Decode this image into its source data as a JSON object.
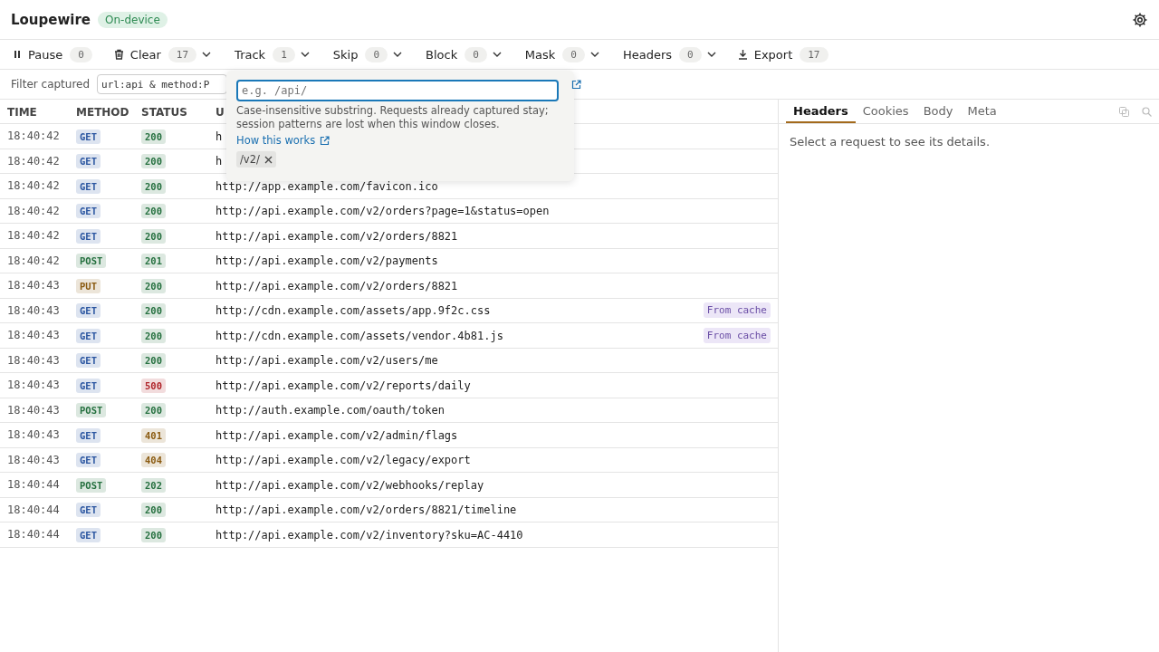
{
  "app": {
    "title": "Loupewire",
    "badge": "On-device"
  },
  "toolbar": [
    {
      "label": "Pause",
      "kind": "pause",
      "count": "0",
      "menu": false
    },
    {
      "label": "Clear",
      "kind": "trash",
      "count": "17",
      "menu": true
    },
    {
      "label": "Track",
      "kind": "plain",
      "count": "1",
      "menu": true
    },
    {
      "label": "Skip",
      "kind": "plain",
      "count": "0",
      "menu": true
    },
    {
      "label": "Block",
      "kind": "plain",
      "count": "0",
      "menu": true
    },
    {
      "label": "Mask",
      "kind": "plain",
      "count": "0",
      "menu": true
    },
    {
      "label": "Headers",
      "kind": "plain",
      "count": "0",
      "menu": true
    },
    {
      "label": "Export",
      "kind": "download",
      "count": "17",
      "menu": false
    }
  ],
  "filter": {
    "label": "Filter captured",
    "value": "url:api & method:P"
  },
  "popover": {
    "placeholder": "e.g. /api/",
    "help": "Case-insensitive substring. Requests already captured stay; session patterns are lost when this window closes.",
    "link": "How this works",
    "chips": [
      "/v2/"
    ]
  },
  "table": {
    "columns": [
      "TIME",
      "METHOD",
      "STATUS",
      "U"
    ],
    "rows": [
      {
        "time": "18:40:42",
        "method": {
          "text": "GET",
          "color": "#2a55a0"
        },
        "status": {
          "text": "200",
          "color": "#25703f"
        },
        "url": "h"
      },
      {
        "time": "18:40:42",
        "method": {
          "text": "GET",
          "color": "#2a55a0"
        },
        "status": {
          "text": "200",
          "color": "#25703f"
        },
        "url": "h"
      },
      {
        "time": "18:40:42",
        "method": {
          "text": "GET",
          "color": "#2a55a0"
        },
        "status": {
          "text": "200",
          "color": "#25703f"
        },
        "url": "http://app.example.com/favicon.ico"
      },
      {
        "time": "18:40:42",
        "method": {
          "text": "GET",
          "color": "#2a55a0"
        },
        "status": {
          "text": "200",
          "color": "#25703f"
        },
        "url": "http://api.example.com/v2/orders?page=1&status=open"
      },
      {
        "time": "18:40:42",
        "method": {
          "text": "GET",
          "color": "#2a55a0"
        },
        "status": {
          "text": "200",
          "color": "#25703f"
        },
        "url": "http://api.example.com/v2/orders/8821"
      },
      {
        "time": "18:40:42",
        "method": {
          "text": "POST",
          "color": "#25703f"
        },
        "status": {
          "text": "201",
          "color": "#25703f"
        },
        "url": "http://api.example.com/v2/payments"
      },
      {
        "time": "18:40:43",
        "method": {
          "text": "PUT",
          "color": "#8a5a10"
        },
        "status": {
          "text": "200",
          "color": "#25703f"
        },
        "url": "http://api.example.com/v2/orders/8821"
      },
      {
        "time": "18:40:43",
        "method": {
          "text": "GET",
          "color": "#2a55a0"
        },
        "status": {
          "text": "200",
          "color": "#25703f"
        },
        "url": "http://cdn.example.com/assets/app.9f2c.css",
        "tag": "From cache"
      },
      {
        "time": "18:40:43",
        "method": {
          "text": "GET",
          "color": "#2a55a0"
        },
        "status": {
          "text": "200",
          "color": "#25703f"
        },
        "url": "http://cdn.example.com/assets/vendor.4b81.js",
        "tag": "From cache"
      },
      {
        "time": "18:40:43",
        "method": {
          "text": "GET",
          "color": "#2a55a0"
        },
        "status": {
          "text": "200",
          "color": "#25703f"
        },
        "url": "http://api.example.com/v2/users/me"
      },
      {
        "time": "18:40:43",
        "method": {
          "text": "GET",
          "color": "#2a55a0"
        },
        "status": {
          "text": "500",
          "color": "#b0242a"
        },
        "url": "http://api.example.com/v2/reports/daily"
      },
      {
        "time": "18:40:43",
        "method": {
          "text": "POST",
          "color": "#25703f"
        },
        "status": {
          "text": "200",
          "color": "#25703f"
        },
        "url": "http://auth.example.com/oauth/token"
      },
      {
        "time": "18:40:43",
        "method": {
          "text": "GET",
          "color": "#2a55a0"
        },
        "status": {
          "text": "401",
          "color": "#8a5a10"
        },
        "url": "http://api.example.com/v2/admin/flags"
      },
      {
        "time": "18:40:43",
        "method": {
          "text": "GET",
          "color": "#2a55a0"
        },
        "status": {
          "text": "404",
          "color": "#8a5a10"
        },
        "url": "http://api.example.com/v2/legacy/export"
      },
      {
        "time": "18:40:44",
        "method": {
          "text": "POST",
          "color": "#25703f"
        },
        "status": {
          "text": "202",
          "color": "#25703f"
        },
        "url": "http://api.example.com/v2/webhooks/replay"
      },
      {
        "time": "18:40:44",
        "method": {
          "text": "GET",
          "color": "#2a55a0"
        },
        "status": {
          "text": "200",
          "color": "#25703f"
        },
        "url": "http://api.example.com/v2/orders/8821/timeline"
      },
      {
        "time": "18:40:44",
        "method": {
          "text": "GET",
          "color": "#2a55a0"
        },
        "status": {
          "text": "200",
          "color": "#25703f"
        },
        "url": "http://api.example.com/v2/inventory?sku=AC-4410"
      }
    ]
  },
  "details": {
    "tabs": [
      {
        "label": "Headers",
        "selected": true
      },
      {
        "label": "Cookies",
        "selected": false
      },
      {
        "label": "Body",
        "selected": false
      },
      {
        "label": "Meta",
        "selected": false
      }
    ],
    "message": "Select a request to see its details."
  }
}
